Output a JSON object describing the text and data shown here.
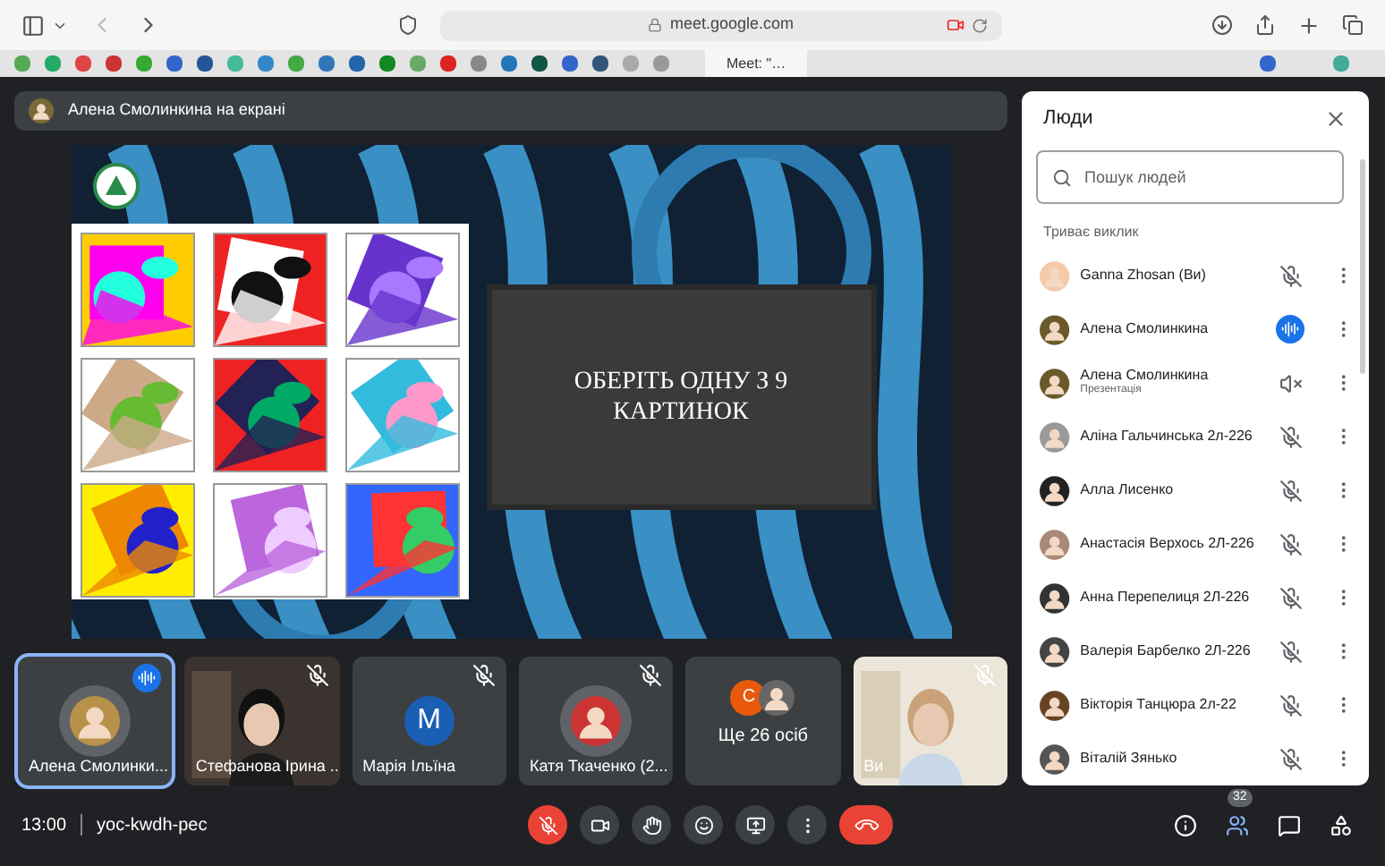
{
  "browser": {
    "url": "meet.google.com",
    "recording": true,
    "tabs": [
      {
        "title": "Meet: \"…",
        "selected": true
      }
    ]
  },
  "banner": {
    "text": "Алена Смолинкина на екрані"
  },
  "slide": {
    "title": "ОБЕРІТЬ ОДНУ З 9 КАРТИНОК"
  },
  "tiles": [
    {
      "kind": "avatar",
      "name": "Алена Смолинки...",
      "muted": false,
      "speaking": true,
      "selected": true
    },
    {
      "kind": "video",
      "name": "Стефанова Ірина ...",
      "muted": true,
      "speaking": false,
      "selected": false
    },
    {
      "kind": "letter",
      "letter": "M",
      "name": "Марія Ільїна",
      "muted": true,
      "speaking": false,
      "selected": false
    },
    {
      "kind": "avatar",
      "name": "Катя Ткаченко (2...",
      "muted": true,
      "speaking": false,
      "selected": false
    },
    {
      "kind": "more",
      "letter": "C",
      "name": "Ще 26 осіб",
      "selected": false
    },
    {
      "kind": "video",
      "name": "Ви",
      "muted": true,
      "speaking": false,
      "selected": false
    }
  ],
  "meeting": {
    "time": "13:00",
    "code": "yoc-kwdh-pec"
  },
  "controls": {
    "mic_on": false,
    "people_count": "32",
    "people_open": true
  },
  "people": {
    "title": "Люди",
    "search": {
      "placeholder": "Пошук людей"
    },
    "section": "Триває виклик",
    "list": [
      {
        "kind": "person",
        "name": "Ganna Zhosan (Ви)",
        "muted": true,
        "speaking": false
      },
      {
        "kind": "person",
        "name": "Алена Смолинкина",
        "muted": false,
        "speaking": true
      },
      {
        "kind": "presentation",
        "name": "Алена Смолинкина",
        "subtitle": "Презентація",
        "muted": true,
        "speaking": false
      },
      {
        "kind": "person",
        "name": "Аліна Гальчинська 2л-226",
        "muted": true,
        "speaking": false
      },
      {
        "kind": "person",
        "name": "Алла Лисенко",
        "muted": true,
        "speaking": false
      },
      {
        "kind": "person",
        "name": "Анастасія Верхось 2Л-226",
        "muted": true,
        "speaking": false
      },
      {
        "kind": "person",
        "name": "Анна Перепелиця 2Л-226",
        "muted": true,
        "speaking": false
      },
      {
        "kind": "person",
        "name": "Валерія Барбелко 2Л-226",
        "muted": true,
        "speaking": false
      },
      {
        "kind": "person",
        "name": "Вікторія Танцюра 2л-22",
        "muted": true,
        "speaking": false
      },
      {
        "kind": "person",
        "name": "Віталій Зянько",
        "muted": true,
        "speaking": false
      }
    ]
  }
}
